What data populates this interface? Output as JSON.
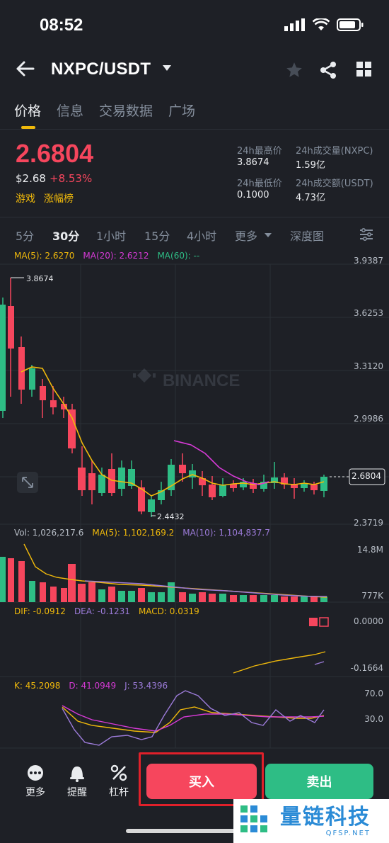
{
  "status_bar": {
    "time": "08:52"
  },
  "header": {
    "pair": "NXPC/USDT"
  },
  "tabs": [
    "价格",
    "信息",
    "交易数据",
    "广场"
  ],
  "price": {
    "last": "2.6804",
    "usd": "$2.68",
    "change": "+8.53%",
    "tags": [
      "游戏",
      "涨幅榜"
    ]
  },
  "stats": {
    "high_label": "24h最高价",
    "high_value": "3.8674",
    "vol_base_label": "24h成交量(NXPC)",
    "vol_base_value": "1.59亿",
    "low_label": "24h最低价",
    "low_value": "0.1000",
    "vol_quote_label": "24h成交额(USDT)",
    "vol_quote_value": "4.73亿"
  },
  "intervals": [
    "5分",
    "30分",
    "1小时",
    "15分",
    "4小时",
    "更多",
    "深度图"
  ],
  "main_chart": {
    "ma5": "MA(5): 2.6270",
    "ma20": "MA(20): 2.6212",
    "ma60": "MA(60): --",
    "axis": [
      "3.9387",
      "3.6253",
      "3.3120",
      "2.9986",
      "2.6804",
      "2.3719"
    ],
    "high_label": "3.8674",
    "low_label": "2.4432",
    "watermark": "BINANCE"
  },
  "volume": {
    "vol": "Vol: 1,026,217.6",
    "ma5": "MA(5): 1,102,169.2",
    "ma10": "MA(10): 1,104,837.7",
    "axis": [
      "14.8M",
      "777K"
    ]
  },
  "macd": {
    "dif": "DIF: -0.0912",
    "dea": "DEA: -0.1231",
    "macd": "MACD: 0.0319",
    "axis": [
      "0.0000",
      "-0.1664"
    ]
  },
  "kdj": {
    "k": "K: 45.2098",
    "d": "D: 41.0949",
    "j": "J: 53.4396",
    "axis": [
      "70.0",
      "30.0"
    ]
  },
  "bottom_bar": {
    "more": "更多",
    "alert": "提醒",
    "leverage": "杠杆",
    "buy": "买入",
    "sell": "卖出"
  },
  "watermark_logo": {
    "text": "量链科技",
    "sub": "QFSP.NET"
  },
  "colors": {
    "up": "#2ebd85",
    "down": "#f6465d",
    "accent": "#f0b90b",
    "bg": "#1e2026"
  }
}
